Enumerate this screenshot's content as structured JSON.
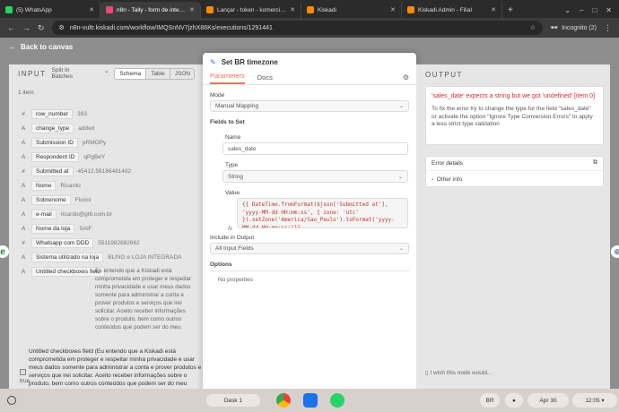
{
  "browser": {
    "tabs": [
      {
        "title": "(5) WhatsApp",
        "color": "#25d366",
        "active": false
      },
      {
        "title": "n8n - Tally - form de interesse",
        "color": "#ea4b71",
        "active": true
      },
      {
        "title": "Lançar - token - komercial - Kiskadi",
        "color": "#ff8a00",
        "active": false
      },
      {
        "title": "Kiskadi",
        "color": "#ff8a00",
        "active": false
      },
      {
        "title": "Kiskadi Admin - Filial",
        "color": "#ff8a00",
        "active": false
      }
    ],
    "url": "n8n-vultr.kiskadi.com/workflow/IMQSnNV7jzhX86Ks/executions/1291441",
    "profile": "Incognito (2)"
  },
  "canvas": {
    "back_label": "Back to canvas"
  },
  "input": {
    "title": "INPUT",
    "node_select": "Split In Batches",
    "tabs": [
      "Schema",
      "Table",
      "JSON"
    ],
    "count": "1 item",
    "fields": [
      {
        "type": "#",
        "name": "row_number",
        "value": "393"
      },
      {
        "type": "A",
        "name": "change_type",
        "value": "added"
      },
      {
        "type": "A",
        "name": "Submission ID",
        "value": "pRMOPy"
      },
      {
        "type": "A",
        "name": "Respondent ID",
        "value": "qPgBeY"
      },
      {
        "type": "#",
        "name": "Submitted at",
        "value": "45412.58186481482"
      },
      {
        "type": "A",
        "name": "Nome",
        "value": "Ricardo"
      },
      {
        "type": "A",
        "name": "Sobrenome",
        "value": "Florini"
      },
      {
        "type": "A",
        "name": "e-mail",
        "value": "ricardo@gt6.com.br"
      },
      {
        "type": "A",
        "name": "Nome da loja",
        "value": "SAIF"
      },
      {
        "type": "#",
        "name": "Whatsapp com DDD",
        "value": "5511982882662"
      },
      {
        "type": "A",
        "name": "Sistema utilizado na loja",
        "value": "BLING e LOJA INTEGRADA"
      },
      {
        "type": "A",
        "name": "Untitled checkboxes field",
        "value": ""
      }
    ],
    "long_value": "Eu entendo que a Kiskadi está comprometida em proteger e respeitar minha privacidade e usar meus dados somente para administrar a conta e prover produtos e serviços que irei solicitar. Aceito receber informações sobre o produto, bem como outros conteúdos que podem ser do meu",
    "overlap_text": "Untitled checkboxes field (Eu entendo que a Kiskadi está comprometida em proteger e respeitar minha privacidade e usar meus dados somente para administrar a conta e prover produtos e serviços que irei solicitar. Aceito receber informações sobre o produto, bem como outros conteúdos que podem ser do meu",
    "checkbox_label": "true"
  },
  "node": {
    "title": "Set BR timezone",
    "tabs": [
      "Parameters",
      "Docs"
    ],
    "mode_label": "Mode",
    "mode_value": "Manual Mapping",
    "fields_label": "Fields to Set",
    "name_label": "Name",
    "name_value": "sales_date",
    "type_label": "Type",
    "type_value": "String",
    "value_label": "Value",
    "fx": "fx",
    "expression": "{{ DateTime.fromFormat($json['Submitted at'], 'yyyy-MM-dd HH:mm:ss', { zone: 'utc' }).setZone('America/Sao_Paulo').toFormat('yyyy-MM-dd HH:mm:ss')}}",
    "include_label": "Include in Output",
    "include_value": "All Input Fields",
    "options_label": "Options",
    "options_empty": "No properties"
  },
  "output": {
    "title": "OUTPUT",
    "error_title": "'sales_date' expects a string but we got 'undefined' [item 0]",
    "error_text": "To fix the error try to change the type for the field \"sales_date\" or activate the option \"Ignore Type Conversion Errors\" to apply a less strict type validation",
    "details_title": "Error details",
    "other_info": "Other info",
    "wish": "I wish this node would..."
  },
  "shelf": {
    "desk": "Desk 1",
    "lang": "BR",
    "date": "Apr 30",
    "time": "12:05"
  },
  "colors": {
    "accent": "#ff6d5a",
    "error": "#d32f2f"
  }
}
